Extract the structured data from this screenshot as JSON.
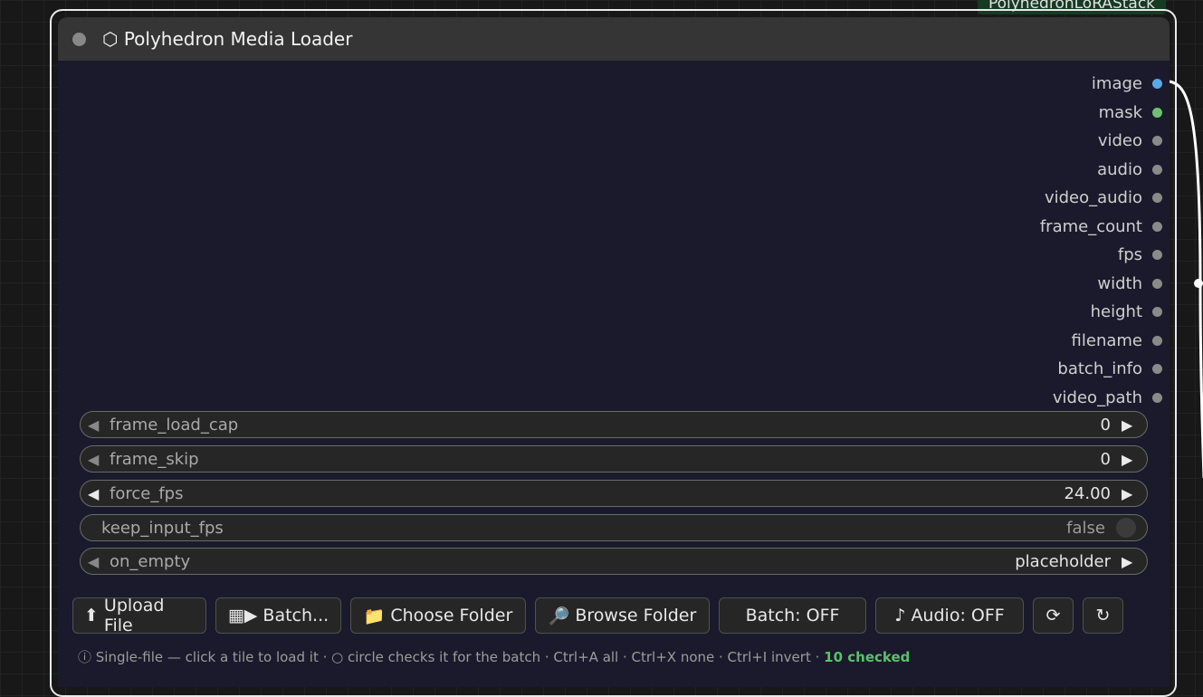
{
  "tag_label": "PolyhedronLoRAStack",
  "node": {
    "title": "⬡ Polyhedron Media Loader"
  },
  "outputs": [
    {
      "label": "image",
      "color": "#5aa7e8"
    },
    {
      "label": "mask",
      "color": "#6cc36f"
    },
    {
      "label": "video",
      "color": "#8a8a8a"
    },
    {
      "label": "audio",
      "color": "#8a8a8a"
    },
    {
      "label": "video_audio",
      "color": "#8a8a8a"
    },
    {
      "label": "frame_count",
      "color": "#8a8a8a"
    },
    {
      "label": "fps",
      "color": "#8a8a8a"
    },
    {
      "label": "width",
      "color": "#8a8a8a"
    },
    {
      "label": "height",
      "color": "#8a8a8a"
    },
    {
      "label": "filename",
      "color": "#8a8a8a"
    },
    {
      "label": "batch_info",
      "color": "#8a8a8a"
    },
    {
      "label": "video_path",
      "color": "#8a8a8a"
    }
  ],
  "widgets": {
    "frame_load_cap": {
      "name": "frame_load_cap",
      "value": "0"
    },
    "frame_skip": {
      "name": "frame_skip",
      "value": "0"
    },
    "force_fps": {
      "name": "force_fps",
      "value": "24.00"
    },
    "keep_input_fps": {
      "name": "keep_input_fps",
      "value": "false"
    },
    "on_empty": {
      "name": "on_empty",
      "value": "placeholder"
    }
  },
  "buttons": {
    "upload": {
      "icon": "⬆",
      "label": "Upload File"
    },
    "batch": {
      "icon": "▦▶",
      "label": "Batch..."
    },
    "choose_folder": {
      "icon": "📁",
      "label": "Choose Folder"
    },
    "browse_folder": {
      "icon": "🔎",
      "label": "Browse Folder"
    },
    "batch_toggle": {
      "label": "Batch: OFF"
    },
    "audio_toggle": {
      "icon": "♪",
      "label": "Audio: OFF"
    },
    "refresh": {
      "icon": "⟳"
    },
    "reload": {
      "icon": "↻"
    }
  },
  "hint": {
    "text": "ⓘ Single-file — click a tile to load it · ○ circle checks it for the batch · Ctrl+A all · Ctrl+X none · Ctrl+I invert ·",
    "count": "10 checked"
  }
}
